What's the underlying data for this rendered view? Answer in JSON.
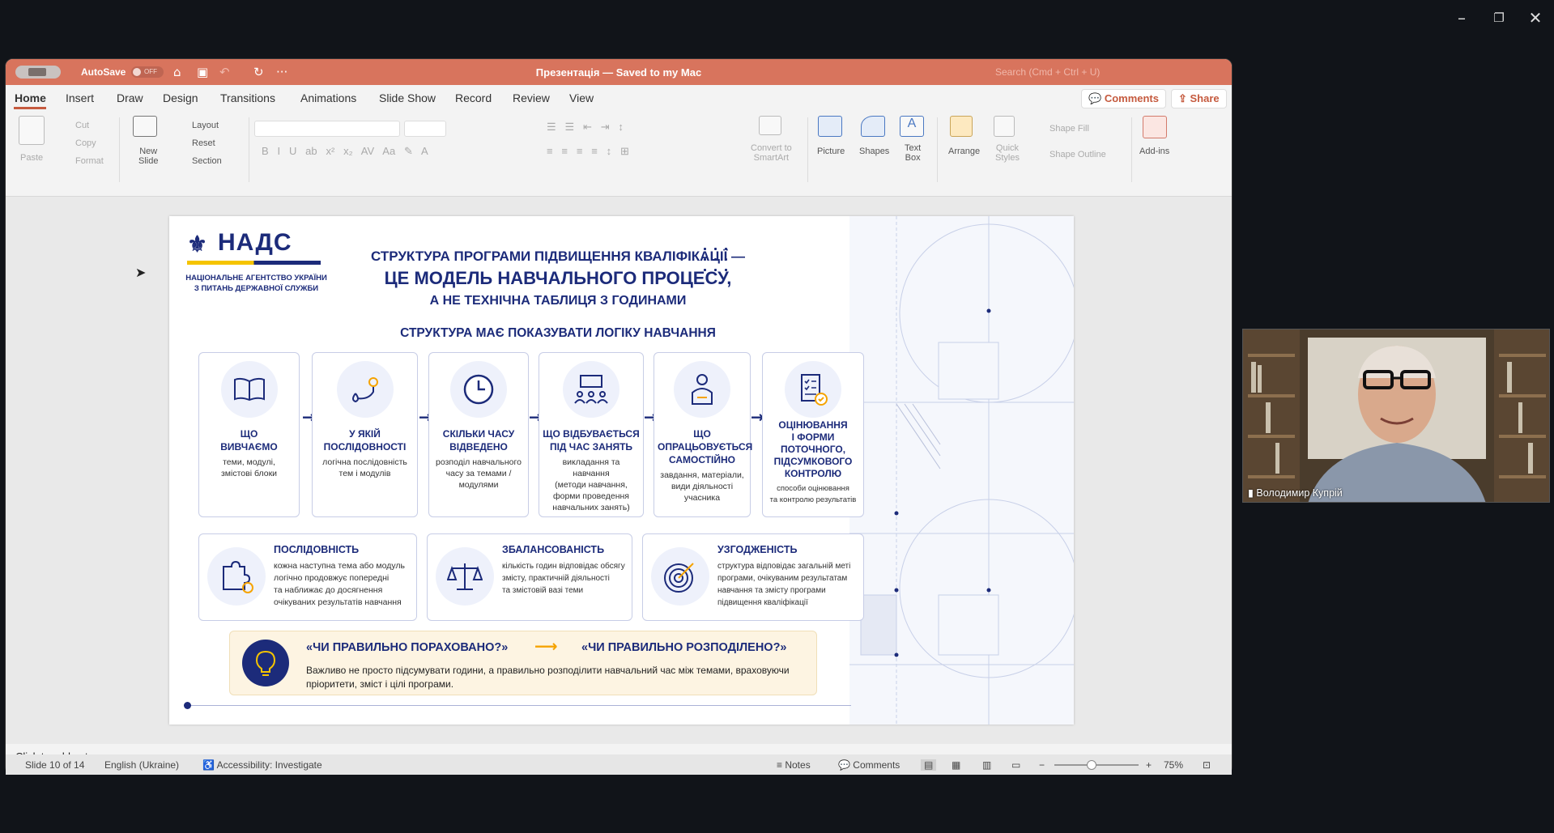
{
  "host": {
    "window_controls": [
      "minimize",
      "restore",
      "close"
    ],
    "webcam": {
      "participant_name": "Володимир Купрій"
    }
  },
  "titlebar": {
    "autosave_label": "AutoSave",
    "autosave_state": "OFF",
    "document_title": "Презентація — Saved to my Mac",
    "search_placeholder": "Search (Cmd + Ctrl + U)"
  },
  "tabs": [
    "Home",
    "Insert",
    "Draw",
    "Design",
    "Transitions",
    "Animations",
    "Slide Show",
    "Record",
    "Review",
    "View"
  ],
  "active_tab": "Home",
  "tab_buttons": {
    "comments": "Comments",
    "share": "Share"
  },
  "ribbon": {
    "paste": "Paste",
    "cut": "Cut",
    "copy": "Copy",
    "format": "Format",
    "new_slide": "New\nSlide",
    "layout": "Layout",
    "reset": "Reset",
    "section": "Section",
    "convert_smartart": "Convert to\nSmartArt",
    "picture": "Picture",
    "shapes": "Shapes",
    "text_box": "Text\nBox",
    "arrange": "Arrange",
    "quick_styles": "Quick\nStyles",
    "shape_fill": "Shape Fill",
    "shape_outline": "Shape Outline",
    "add_ins": "Add-ins"
  },
  "slide": {
    "logo": "НАДС",
    "logo_subtitle": "НАЦІОНАЛЬНЕ АГЕНТСТВО УКРАЇНИ З ПИТАНЬ ДЕРЖАВНОЇ СЛУЖБИ",
    "title_line1": "СТРУКТУРА ПРОГРАМИ ПІДВИЩЕННЯ КВАЛІФІКАЦІЇ —",
    "title_line2": "ЦЕ МОДЕЛЬ НАВЧАЛЬНОГО ПРОЦЕСУ,",
    "title_line3": "А НЕ ТЕХНІЧНА ТАБЛИЦЯ З ГОДИНАМИ",
    "subhead": "СТРУКТУРА МАЄ ПОКАЗУВАТИ ЛОГІКУ НАВЧАННЯ",
    "steps": [
      {
        "title": "ЩО\nВИВЧАЄМО",
        "desc": "теми, модулі,\nзмістові блоки",
        "icon": "book-icon"
      },
      {
        "title": "У ЯКІЙ\nПОСЛІДОВНОСТІ",
        "desc": "логічна послідовність\nтем і модулів",
        "icon": "route-icon"
      },
      {
        "title": "СКІЛЬКИ ЧАСУ\nВІДВЕДЕНО",
        "desc": "розподіл навчального\nчасу за темами /\nмодулями",
        "icon": "clock-icon"
      },
      {
        "title": "ЩО ВІДБУВАЄТЬСЯ\nПІД ЧАС ЗАНЯТЬ",
        "desc": "викладання та навчання\n(методи навчання,\nформи проведення\nнавчальних занять)",
        "icon": "classroom-icon"
      },
      {
        "title": "ЩО\nОПРАЦЬОВУЄТЬСЯ\nСАМОСТІЙНО",
        "desc": "завдання, матеріали,\nвиди діяльності\nучасника",
        "icon": "learner-icon"
      },
      {
        "title": "ОЦІНЮВАННЯ\nІ ФОРМИ\nПОТОЧНОГО,\nПІДСУМКОВОГО\nКОНТРОЛЮ",
        "desc": "способи оцінювання\nта контролю результатів",
        "icon": "checklist-icon"
      }
    ],
    "principles": [
      {
        "title": "ПОСЛІДОВНІСТЬ",
        "desc": "кожна наступна тема або модуль\nлогічно продовжує попередні\nта наближає до досягнення\nочікуваних результатів навчання",
        "icon": "puzzle-icon"
      },
      {
        "title": "ЗБАЛАНСОВАНІСТЬ",
        "desc": "кількість годин відповідає обсягу\nзмісту, практичній діяльності\nта змістовій вазі теми",
        "icon": "scales-icon"
      },
      {
        "title": "УЗГОДЖЕНІСТЬ",
        "desc": "структура відповідає загальній меті\nпрограми, очікуваним результатам\nнавчання та змісту програми\nпідвищення кваліфікації",
        "icon": "target-icon"
      }
    ],
    "callout_q1": "«ЧИ ПРАВИЛЬНО ПОРАХОВАНО?»",
    "callout_q2": "«ЧИ ПРАВИЛЬНО РОЗПОДІЛЕНО?»",
    "callout_desc": "Важливо не просто підсумувати години, а правильно розподілити навчальний час між темами, враховуючи пріоритети, зміст і цілі програми."
  },
  "notes_placeholder": "Click to add notes",
  "status": {
    "slide_indicator": "Slide 10 of 14",
    "language": "English (Ukraine)",
    "accessibility": "Accessibility: Investigate",
    "notes": "Notes",
    "comments": "Comments",
    "zoom": "75%",
    "zoom_fraction": 0.38
  },
  "colors": {
    "titlebar": "#d8745d",
    "brand_navy": "#1c2b7a",
    "accent_yellow": "#f5c400"
  }
}
